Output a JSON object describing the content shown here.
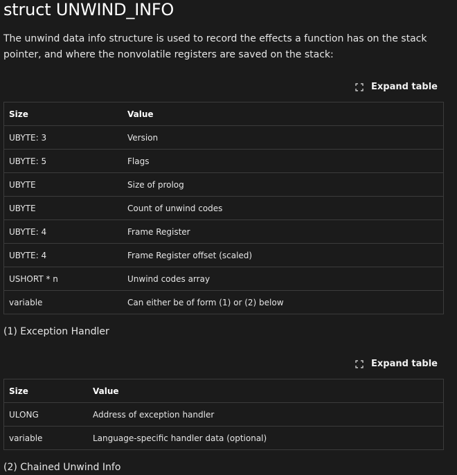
{
  "heading": "struct UNWIND_INFO",
  "intro": "The unwind data info structure is used to record the effects a function has on the stack pointer, and where the nonvolatile registers are saved on the stack:",
  "expand_label": "Expand table",
  "table1": {
    "headers": [
      "Size",
      "Value"
    ],
    "rows": [
      [
        "UBYTE: 3",
        "Version"
      ],
      [
        "UBYTE: 5",
        "Flags"
      ],
      [
        "UBYTE",
        "Size of prolog"
      ],
      [
        "UBYTE",
        "Count of unwind codes"
      ],
      [
        "UBYTE: 4",
        "Frame Register"
      ],
      [
        "UBYTE: 4",
        "Frame Register offset (scaled)"
      ],
      [
        "USHORT * n",
        "Unwind codes array"
      ],
      [
        "variable",
        "Can either be of form (1) or (2) below"
      ]
    ]
  },
  "section1_heading": "(1) Exception Handler",
  "table2": {
    "headers": [
      "Size",
      "Value"
    ],
    "rows": [
      [
        "ULONG",
        "Address of exception handler"
      ],
      [
        "variable",
        "Language-specific handler data (optional)"
      ]
    ]
  },
  "section2_heading": "(2) Chained Unwind Info",
  "icons": {
    "expand": "fullscreen-corners-icon"
  }
}
